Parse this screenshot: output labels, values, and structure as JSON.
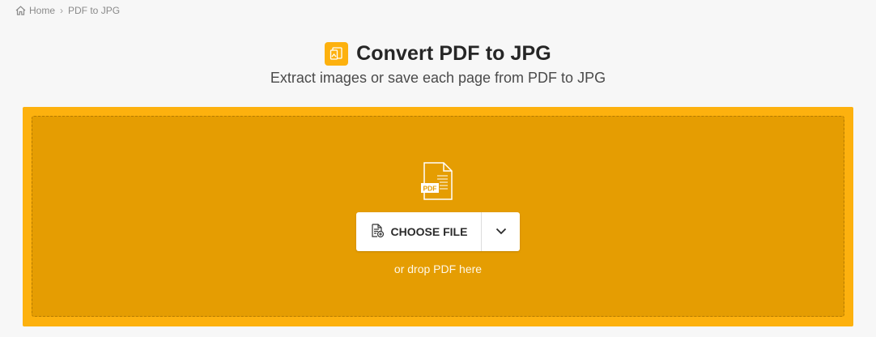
{
  "breadcrumb": {
    "home_label": "Home",
    "separator": "›",
    "current_label": "PDF to JPG"
  },
  "header": {
    "title": "Convert PDF to JPG",
    "subtitle": "Extract images or save each page from PDF to JPG"
  },
  "dropzone": {
    "file_icon_text": "PDF",
    "choose_file_label": "CHOOSE FILE",
    "drop_hint": "or drop PDF here"
  },
  "colors": {
    "accent": "#fdb10e",
    "dropzone_outer": "#fdb10e",
    "dropzone_inner": "#e59d02",
    "background": "#f7f7f7"
  },
  "icons": {
    "home": "home-icon",
    "title": "image-convert-icon",
    "file": "pdf-file-icon",
    "choose": "add-file-icon",
    "dropdown": "chevron-down-icon"
  }
}
